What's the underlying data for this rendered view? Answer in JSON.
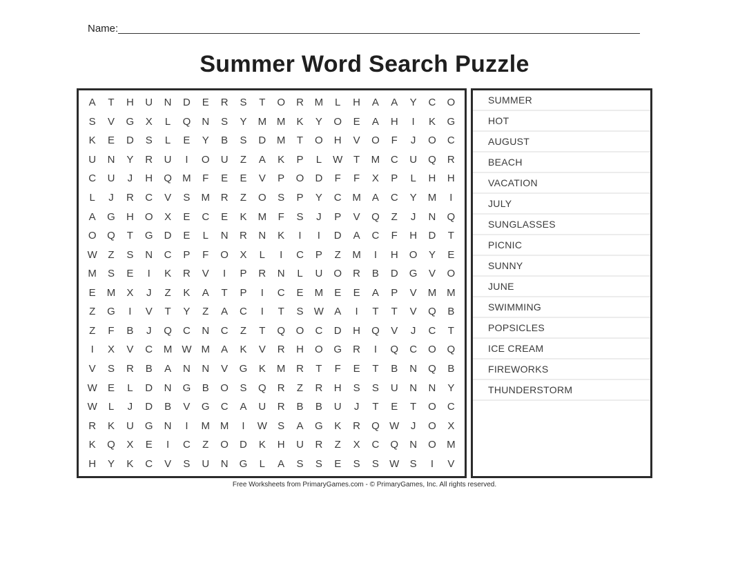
{
  "worksheet": {
    "name_label": "Name:",
    "title": "Summer Word Search Puzzle",
    "footer": "Free Worksheets from PrimaryGames.com - © PrimaryGames, Inc. All rights reserved."
  },
  "grid": {
    "rows": 20,
    "cols": 20,
    "letters": [
      [
        "A",
        "T",
        "H",
        "U",
        "N",
        "D",
        "E",
        "R",
        "S",
        "T",
        "O",
        "R",
        "M",
        "L",
        "H",
        "A",
        "A",
        "Y",
        "C",
        "O"
      ],
      [
        "S",
        "V",
        "G",
        "X",
        "L",
        "Q",
        "N",
        "S",
        "Y",
        "M",
        "M",
        "K",
        "Y",
        "O",
        "E",
        "A",
        "H",
        "I",
        "K",
        "G"
      ],
      [
        "K",
        "E",
        "D",
        "S",
        "L",
        "E",
        "Y",
        "B",
        "S",
        "D",
        "M",
        "T",
        "O",
        "H",
        "V",
        "O",
        "F",
        "J",
        "O",
        "C"
      ],
      [
        "U",
        "N",
        "Y",
        "R",
        "U",
        "I",
        "O",
        "U",
        "Z",
        "A",
        "K",
        "P",
        "L",
        "W",
        "T",
        "M",
        "C",
        "U",
        "Q",
        "R"
      ],
      [
        "C",
        "U",
        "J",
        "H",
        "Q",
        "M",
        "F",
        "E",
        "E",
        "V",
        "P",
        "O",
        "D",
        "F",
        "F",
        "X",
        "P",
        "L",
        "H",
        "H"
      ],
      [
        "L",
        "J",
        "R",
        "C",
        "V",
        "S",
        "M",
        "R",
        "Z",
        "O",
        "S",
        "P",
        "Y",
        "C",
        "M",
        "A",
        "C",
        "Y",
        "M",
        "I"
      ],
      [
        "A",
        "G",
        "H",
        "O",
        "X",
        "E",
        "C",
        "E",
        "K",
        "M",
        "F",
        "S",
        "J",
        "P",
        "V",
        "Q",
        "Z",
        "J",
        "N",
        "Q"
      ],
      [
        "O",
        "Q",
        "T",
        "G",
        "D",
        "E",
        "L",
        "N",
        "R",
        "N",
        "K",
        "I",
        "I",
        "D",
        "A",
        "C",
        "F",
        "H",
        "D",
        "T"
      ],
      [
        "W",
        "Z",
        "S",
        "N",
        "C",
        "P",
        "F",
        "O",
        "X",
        "L",
        "I",
        "C",
        "P",
        "Z",
        "M",
        "I",
        "H",
        "O",
        "Y",
        "E"
      ],
      [
        "M",
        "S",
        "E",
        "I",
        "K",
        "R",
        "V",
        "I",
        "P",
        "R",
        "N",
        "L",
        "U",
        "O",
        "R",
        "B",
        "D",
        "G",
        "V",
        "O"
      ],
      [
        "E",
        "M",
        "X",
        "J",
        "Z",
        "K",
        "A",
        "T",
        "P",
        "I",
        "C",
        "E",
        "M",
        "E",
        "E",
        "A",
        "P",
        "V",
        "M",
        "M"
      ],
      [
        "Z",
        "G",
        "I",
        "V",
        "T",
        "Y",
        "Z",
        "A",
        "C",
        "I",
        "T",
        "S",
        "W",
        "A",
        "I",
        "T",
        "T",
        "V",
        "Q",
        "B"
      ],
      [
        "Z",
        "F",
        "B",
        "J",
        "Q",
        "C",
        "N",
        "C",
        "Z",
        "T",
        "Q",
        "O",
        "C",
        "D",
        "H",
        "Q",
        "V",
        "J",
        "C",
        "T"
      ],
      [
        "I",
        "X",
        "V",
        "C",
        "M",
        "W",
        "M",
        "A",
        "K",
        "V",
        "R",
        "H",
        "O",
        "G",
        "R",
        "I",
        "Q",
        "C",
        "O",
        "Q"
      ],
      [
        "V",
        "S",
        "R",
        "B",
        "A",
        "N",
        "N",
        "V",
        "G",
        "K",
        "M",
        "R",
        "T",
        "F",
        "E",
        "T",
        "B",
        "N",
        "Q",
        "B"
      ],
      [
        "W",
        "E",
        "L",
        "D",
        "N",
        "G",
        "B",
        "O",
        "S",
        "Q",
        "R",
        "Z",
        "R",
        "H",
        "S",
        "S",
        "U",
        "N",
        "N",
        "Y"
      ],
      [
        "W",
        "L",
        "J",
        "D",
        "B",
        "V",
        "G",
        "C",
        "A",
        "U",
        "R",
        "B",
        "B",
        "U",
        "J",
        "T",
        "E",
        "T",
        "O",
        "C"
      ],
      [
        "R",
        "K",
        "U",
        "G",
        "N",
        "I",
        "M",
        "M",
        "I",
        "W",
        "S",
        "A",
        "G",
        "K",
        "R",
        "Q",
        "W",
        "J",
        "O",
        "X"
      ],
      [
        "K",
        "Q",
        "X",
        "E",
        "I",
        "C",
        "Z",
        "O",
        "D",
        "K",
        "H",
        "U",
        "R",
        "Z",
        "X",
        "C",
        "Q",
        "N",
        "O",
        "M"
      ],
      [
        "H",
        "Y",
        "K",
        "C",
        "V",
        "S",
        "U",
        "N",
        "G",
        "L",
        "A",
        "S",
        "S",
        "E",
        "S",
        "S",
        "W",
        "S",
        "I",
        "V"
      ]
    ]
  },
  "word_list": {
    "words": [
      "SUMMER",
      "HOT",
      "AUGUST",
      "BEACH",
      "VACATION",
      "JULY",
      "SUNGLASSES",
      "PICNIC",
      "SUNNY",
      "JUNE",
      "SWIMMING",
      "POPSICLES",
      "ICE CREAM",
      "FIREWORKS",
      "THUNDERSTORM"
    ]
  }
}
